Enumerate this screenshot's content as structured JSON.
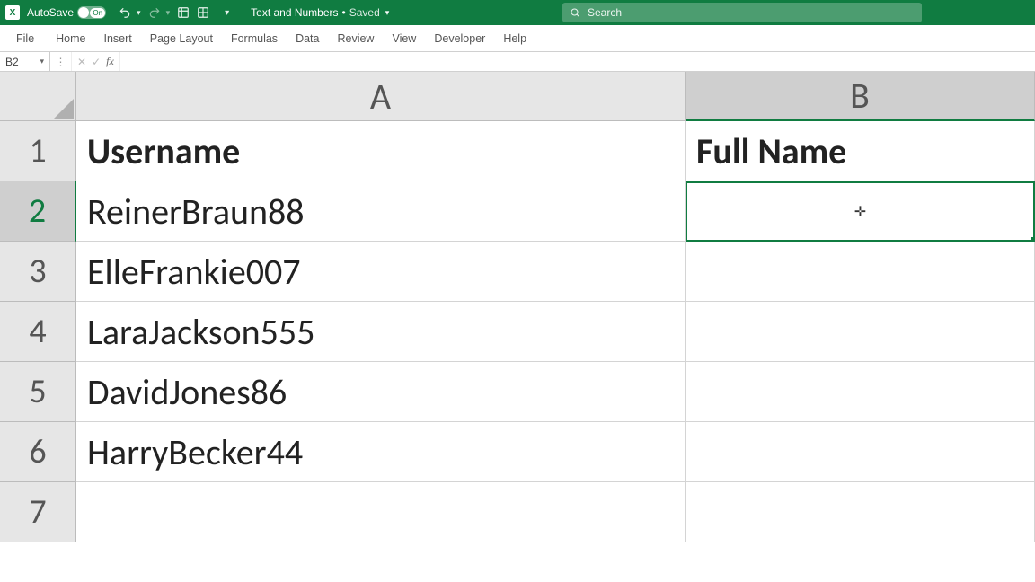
{
  "titlebar": {
    "autosave_label": "AutoSave",
    "toggle_state": "On",
    "filename": "Text and Numbers",
    "save_status": "Saved",
    "search_placeholder": "Search"
  },
  "ribbon": {
    "tabs": [
      "File",
      "Home",
      "Insert",
      "Page Layout",
      "Formulas",
      "Data",
      "Review",
      "View",
      "Developer",
      "Help"
    ]
  },
  "formula_bar": {
    "name_box": "B2",
    "fx_label": "fx",
    "formula": ""
  },
  "grid": {
    "columns": [
      "A",
      "B"
    ],
    "selected_column": "B",
    "selected_row": "2",
    "selected_cell": "B2",
    "rows": [
      {
        "num": "1",
        "a": "Username",
        "b": "Full Name",
        "bold": true
      },
      {
        "num": "2",
        "a": "ReinerBraun88",
        "b": ""
      },
      {
        "num": "3",
        "a": "ElleFrankie007",
        "b": ""
      },
      {
        "num": "4",
        "a": "LaraJackson555",
        "b": ""
      },
      {
        "num": "5",
        "a": "DavidJones86",
        "b": ""
      },
      {
        "num": "6",
        "a": "HarryBecker44",
        "b": ""
      },
      {
        "num": "7",
        "a": "",
        "b": ""
      }
    ]
  }
}
